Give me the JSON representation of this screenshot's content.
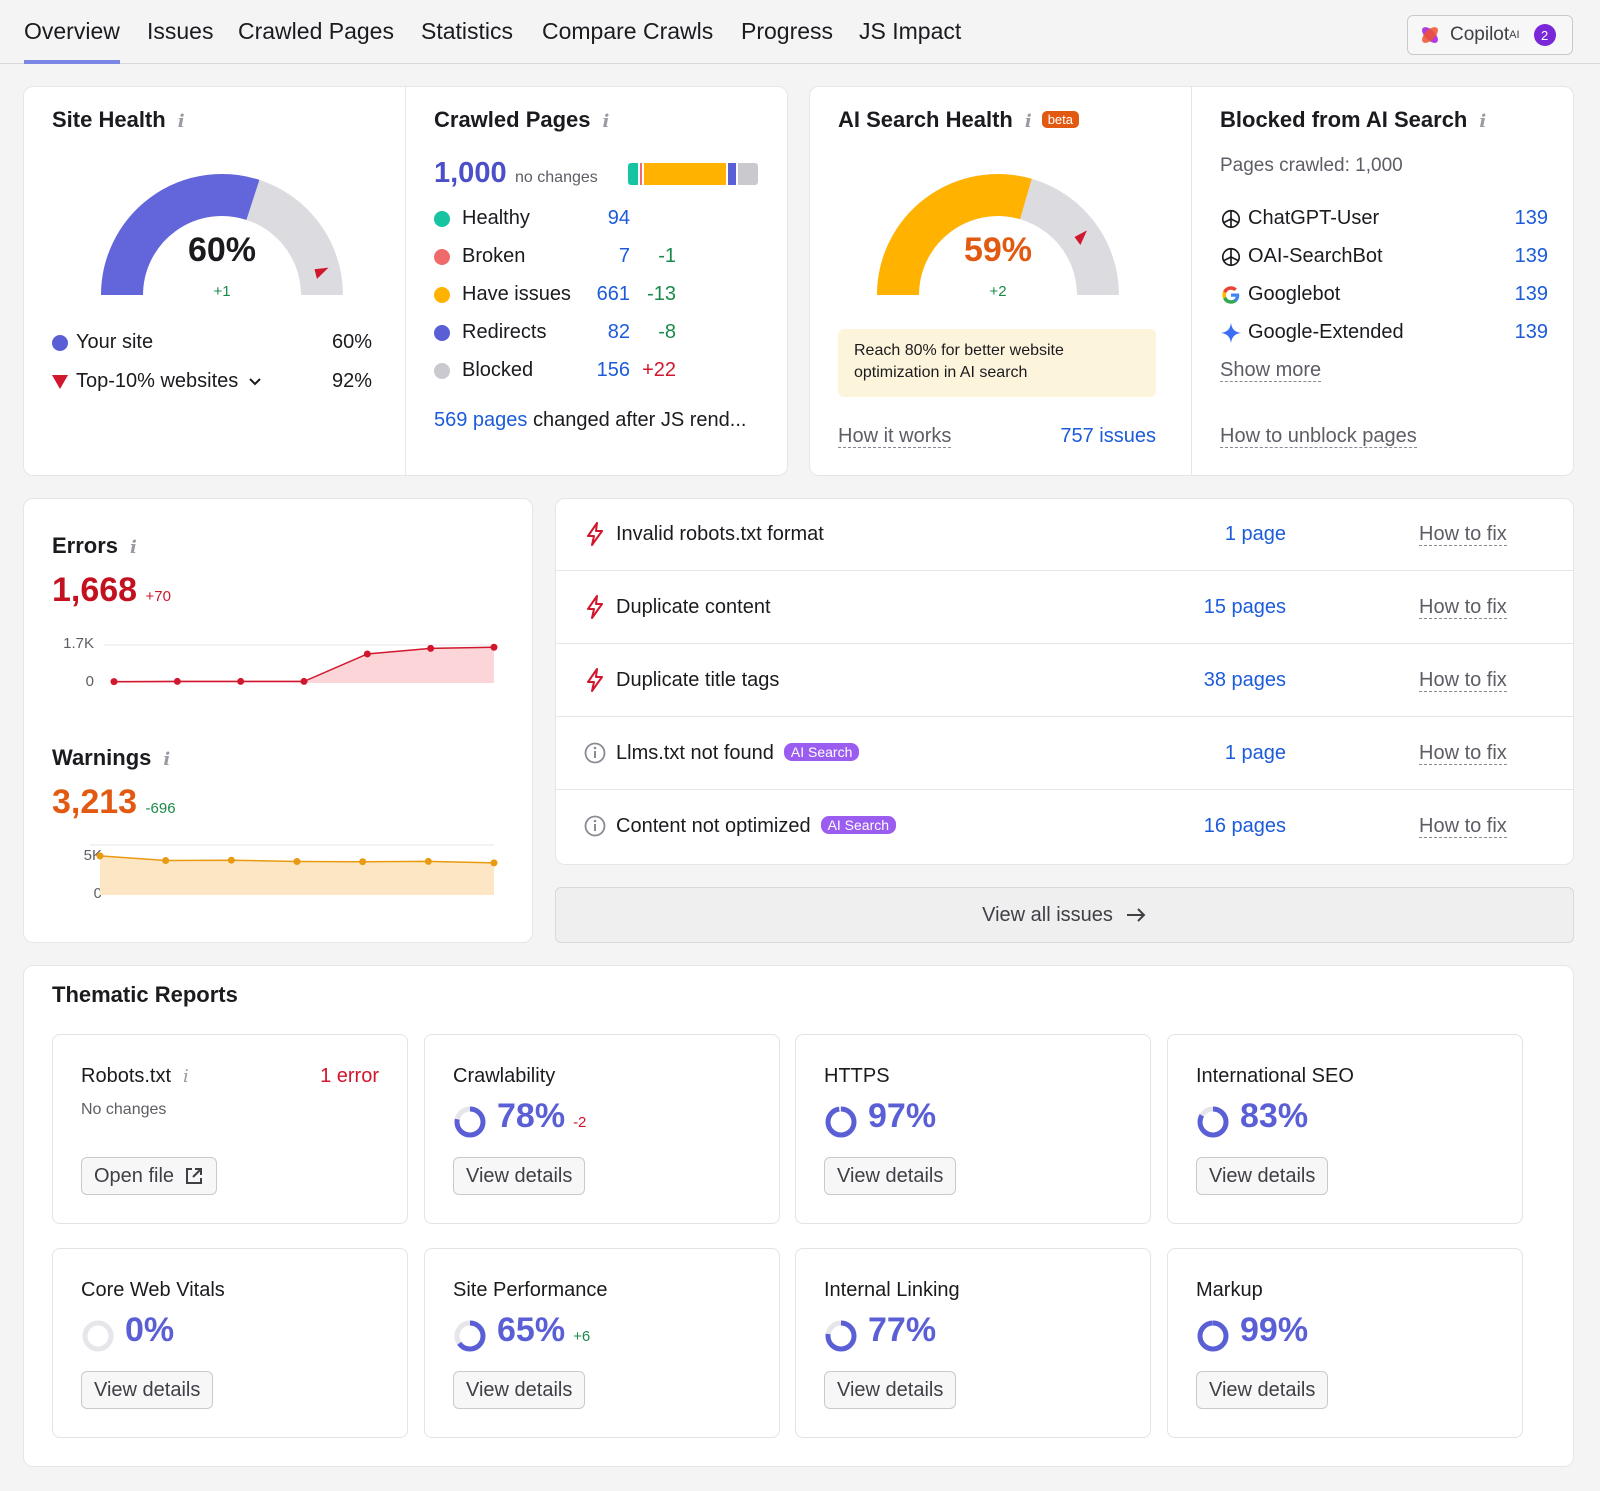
{
  "tabs": [
    {
      "label": "Overview",
      "active": true
    },
    {
      "label": "Issues"
    },
    {
      "label": "Crawled Pages"
    },
    {
      "label": "Statistics"
    },
    {
      "label": "Compare Crawls"
    },
    {
      "label": "Progress"
    },
    {
      "label": "JS Impact"
    }
  ],
  "copilot": {
    "label": "Copilot",
    "sup": "AI",
    "count": "2"
  },
  "site_health": {
    "title": "Site Health",
    "value": "60%",
    "delta": "+1",
    "gauge_fraction": 0.6,
    "marker_fraction": 0.92,
    "legend": [
      {
        "label": "Your site",
        "value": "60%",
        "color": "#5a5fd6"
      },
      {
        "label": "Top-10% websites",
        "value": "92%",
        "color": "#d1172d"
      }
    ]
  },
  "crawled_pages": {
    "title": "Crawled Pages",
    "total": "1,000",
    "total_note": "no changes",
    "bar": [
      {
        "value": 94,
        "color": "#16c4a1"
      },
      {
        "value": 7,
        "color": "#ef6b6b"
      },
      {
        "value": 661,
        "color": "#ffb300"
      },
      {
        "value": 82,
        "color": "#5a5fd6"
      },
      {
        "value": 156,
        "color": "#c9c9cf"
      }
    ],
    "rows": [
      {
        "label": "Healthy",
        "count": "94",
        "delta": "",
        "color": "#16c4a1"
      },
      {
        "label": "Broken",
        "count": "7",
        "delta": "-1",
        "color": "#ef6b6b",
        "delta_type": "pos"
      },
      {
        "label": "Have issues",
        "count": "661",
        "delta": "-13",
        "color": "#ffb300",
        "delta_type": "pos"
      },
      {
        "label": "Redirects",
        "count": "82",
        "delta": "-8",
        "color": "#5a5fd6",
        "delta_type": "pos"
      },
      {
        "label": "Blocked",
        "count": "156",
        "delta": "+22",
        "color": "#c9c9cf",
        "delta_type": "neg"
      }
    ],
    "js_link": "569 pages",
    "js_text": "changed after JS rend..."
  },
  "ai_health": {
    "title": "AI Search Health",
    "beta": "beta",
    "value": "59%",
    "delta": "+2",
    "gauge_fraction": 0.59,
    "marker_fraction": 0.8,
    "reach_text": "Reach 80% for better website optimization in AI search",
    "how_it_works": "How it works",
    "issues_link": "757 issues"
  },
  "blocked_ai": {
    "title": "Blocked from AI Search",
    "pages_crawled": "Pages crawled: 1,000",
    "bots": [
      {
        "name": "ChatGPT-User",
        "count": "139",
        "icon": "openai-icon"
      },
      {
        "name": "OAI-SearchBot",
        "count": "139",
        "icon": "openai-icon"
      },
      {
        "name": "Googlebot",
        "count": "139",
        "icon": "google-icon"
      },
      {
        "name": "Google-Extended",
        "count": "139",
        "icon": "gemini-icon"
      }
    ],
    "show_more": "Show more",
    "unblock": "How to unblock pages"
  },
  "errors": {
    "title": "Errors",
    "value": "1,668",
    "delta": "+70",
    "y_top": "1.7K",
    "y_bottom": "0",
    "ymax": 1700,
    "series": [
      60,
      70,
      70,
      70,
      1300,
      1550,
      1600
    ],
    "color": "#d1172d",
    "fill": "#fcd5d9"
  },
  "warnings": {
    "title": "Warnings",
    "value": "3,213",
    "delta": "-696",
    "y_top": "5K",
    "y_bottom": "0",
    "ymax": 5000,
    "series": [
      3909,
      3450,
      3480,
      3350,
      3330,
      3360,
      3213
    ],
    "color": "#e89a10",
    "fill": "#fde6c4"
  },
  "issues": [
    {
      "name": "Invalid robots.txt format",
      "count": "1 page",
      "fix": "How to fix",
      "type": "error",
      "tag": ""
    },
    {
      "name": "Duplicate content",
      "count": "15 pages",
      "fix": "How to fix",
      "type": "error",
      "tag": ""
    },
    {
      "name": "Duplicate title tags",
      "count": "38 pages",
      "fix": "How to fix",
      "type": "error",
      "tag": ""
    },
    {
      "name": "Llms.txt not found",
      "count": "1 page",
      "fix": "How to fix",
      "type": "notice",
      "tag": "AI Search"
    },
    {
      "name": "Content not optimized",
      "count": "16 pages",
      "fix": "How to fix",
      "type": "notice",
      "tag": "AI Search"
    }
  ],
  "view_all": "View all issues",
  "thematic": {
    "title": "Thematic Reports",
    "robots": {
      "name": "Robots.txt",
      "status": "1 error",
      "note": "No changes",
      "button": "Open file"
    },
    "reports": [
      {
        "name": "Crawlability",
        "pct": "78%",
        "fraction": 0.78,
        "delta": "-2",
        "delta_type": "neg",
        "button": "View details"
      },
      {
        "name": "HTTPS",
        "pct": "97%",
        "fraction": 0.97,
        "delta": "",
        "button": "View details"
      },
      {
        "name": "International SEO",
        "pct": "83%",
        "fraction": 0.83,
        "delta": "",
        "button": "View details"
      },
      {
        "name": "Core Web Vitals",
        "pct": "0%",
        "fraction": 0,
        "delta": "",
        "button": "View details"
      },
      {
        "name": "Site Performance",
        "pct": "65%",
        "fraction": 0.65,
        "delta": "+6",
        "delta_type": "pos",
        "button": "View details"
      },
      {
        "name": "Internal Linking",
        "pct": "77%",
        "fraction": 0.77,
        "delta": "",
        "button": "View details"
      },
      {
        "name": "Markup",
        "pct": "99%",
        "fraction": 0.99,
        "delta": "",
        "button": "View details"
      }
    ]
  }
}
